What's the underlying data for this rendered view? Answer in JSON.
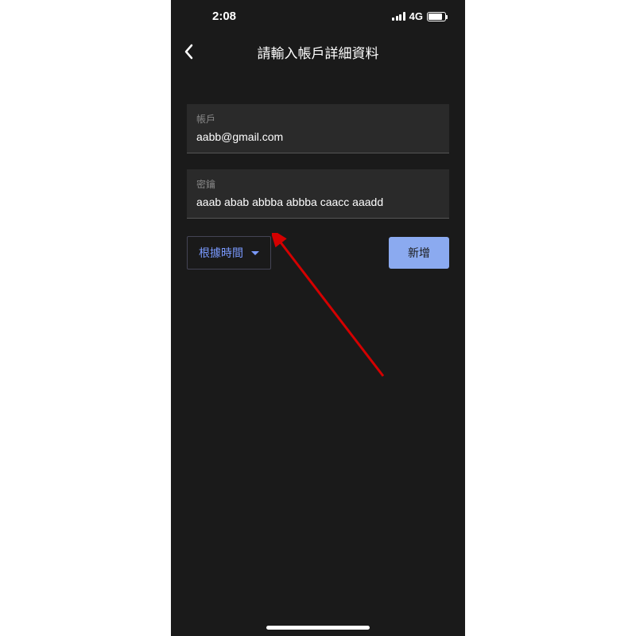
{
  "status_bar": {
    "time": "2:08",
    "network": "4G"
  },
  "nav": {
    "title": "請輸入帳戶詳細資料"
  },
  "form": {
    "account": {
      "label": "帳戶",
      "value": "aabb@gmail.com"
    },
    "secret": {
      "label": "密鑰",
      "value": "aaab abab abbba abbba caacc aaadd"
    }
  },
  "actions": {
    "dropdown_label": "根據時間",
    "submit_label": "新增"
  }
}
